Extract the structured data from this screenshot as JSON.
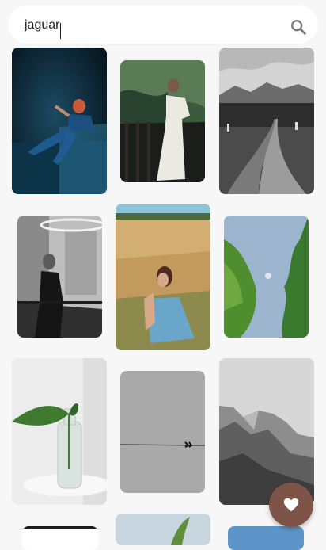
{
  "search": {
    "value": "jaguar",
    "placeholder": ""
  },
  "fab": {
    "icon": "heart-icon",
    "color": "#7d5447"
  },
  "grid": {
    "images": [
      {
        "name": "image-man-on-ledge-blue"
      },
      {
        "name": "image-woman-white-dress-balcony"
      },
      {
        "name": "image-mountain-road"
      },
      {
        "name": "image-woman-black-dress-stairs"
      },
      {
        "name": "image-woman-wheat-field"
      },
      {
        "name": "image-tree-blue-sky-moon"
      },
      {
        "name": "image-plant-in-glass-bottle"
      },
      {
        "name": "image-gray-minimal-birds"
      },
      {
        "name": "image-rocky-mountains"
      },
      {
        "name": "image-partial-dark"
      },
      {
        "name": "image-partial-plant"
      },
      {
        "name": "image-partial-blue"
      }
    ]
  }
}
